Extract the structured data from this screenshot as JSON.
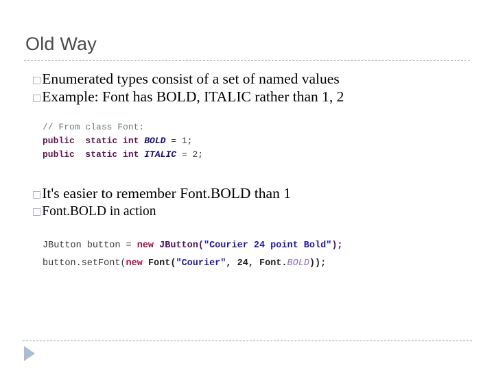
{
  "slide": {
    "title": "Old Way",
    "bullet_marker": "□",
    "group_one": [
      {
        "text": "Enumerated types consist of a set of named values"
      },
      {
        "text": "Example: Font has BOLD, ITALIC rather than 1, 2"
      }
    ],
    "code_one": {
      "lines": [
        [
          {
            "t": "// From class Font:",
            "c": "comment"
          }
        ],
        [
          {
            "t": "public  static int ",
            "c": "keyword"
          },
          {
            "t": "BOLD",
            "c": "field"
          },
          {
            "t": " = 1;",
            "c": "plain"
          }
        ],
        [
          {
            "t": "public  static int ",
            "c": "keyword"
          },
          {
            "t": "ITALIC",
            "c": "field"
          },
          {
            "t": " = 2;",
            "c": "plain"
          }
        ]
      ]
    },
    "group_two": [
      {
        "text": "It's easier to remember Font.BOLD than 1"
      },
      {
        "text": "Font.BOLD in action"
      }
    ],
    "code_two": {
      "lines": [
        [
          {
            "t": "JButton button = ",
            "c": "plain"
          },
          {
            "t": "new",
            "c": "new"
          },
          {
            "t": " ",
            "c": "plain"
          },
          {
            "t": "JButton(",
            "c": "type"
          },
          {
            "t": "\"Courier 24 point Bold\"",
            "c": "string"
          },
          {
            "t": ");",
            "c": "punct"
          }
        ],
        [
          {
            "t": "button.setFont(",
            "c": "plain"
          },
          {
            "t": "new",
            "c": "new2"
          },
          {
            "t": " ",
            "c": "plain"
          },
          {
            "t": "Font(",
            "c": "plain-b"
          },
          {
            "t": "\"Courier\"",
            "c": "string"
          },
          {
            "t": ", 24, Font.",
            "c": "plain-b"
          },
          {
            "t": "BOLD",
            "c": "const"
          },
          {
            "t": "));",
            "c": "plain-b"
          }
        ]
      ]
    },
    "footer": {
      "arrow_icon": "play-triangle-icon"
    },
    "colors": {
      "title": "#4a4a4a",
      "bullet": "#9a99b0",
      "rule": "#b6b6b6",
      "footer_rule": "#8c9bb0",
      "footer_arrow": "#a9bed5",
      "comment": "#6d7c77",
      "keyword": "#5c1550",
      "field": "#120a7a",
      "string": "#2018a8",
      "new": "#9b0d3e",
      "type": "#4b1060",
      "const": "#8d6fbf"
    }
  }
}
